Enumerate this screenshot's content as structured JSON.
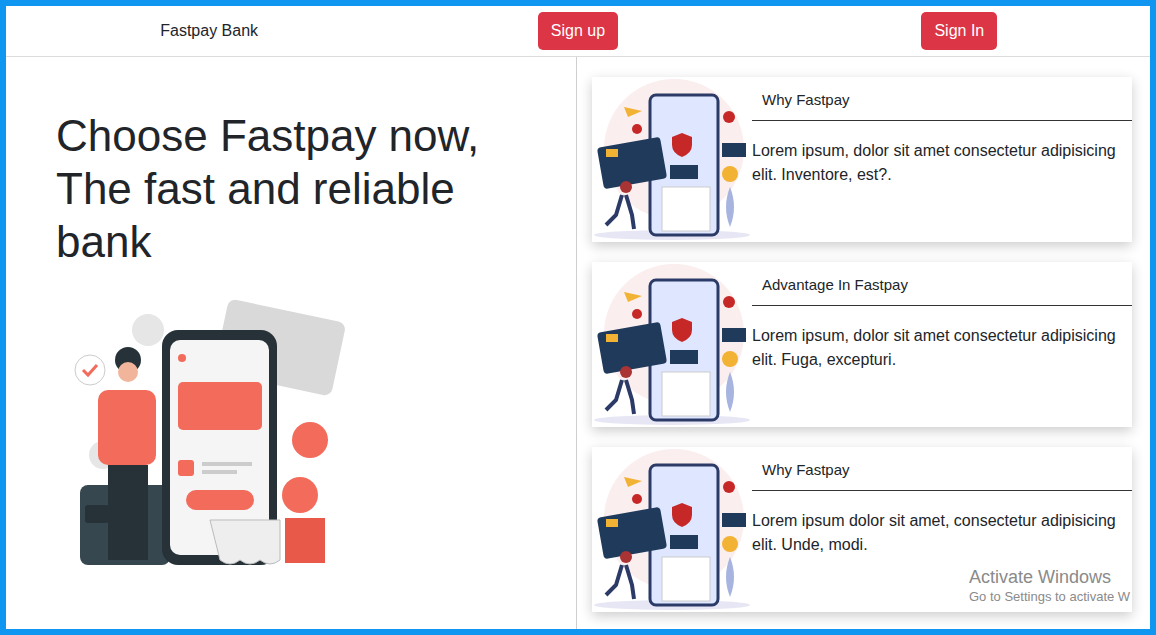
{
  "brand": "Fastpay Bank",
  "nav_buttons": [
    {
      "label": "Sign up"
    },
    {
      "label": "Sign In"
    }
  ],
  "hero": {
    "heading_lines": [
      "Choose Fastpay now,",
      "The fast and reliable bank"
    ]
  },
  "cards": [
    {
      "title": "Why Fastpay",
      "text": "Lorem ipsum, dolor sit amet consectetur adipisicing elit. Inventore, est?."
    },
    {
      "title": "Advantage In Fastpay",
      "text": "Lorem ipsum, dolor sit amet consectetur adipisicing elit. Fuga, excepturi."
    },
    {
      "title": "Why Fastpay",
      "text": "Lorem ipsum dolor sit amet, consectetur adipisicing elit. Unde, modi."
    }
  ],
  "watermark": {
    "title": "Activate Windows",
    "subtitle": "Go to Settings to activate W"
  }
}
